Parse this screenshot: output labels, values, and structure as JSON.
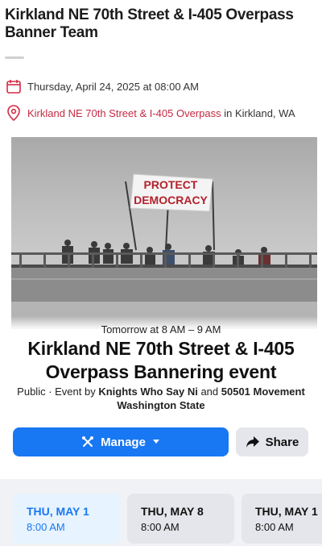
{
  "page": {
    "title": "Kirkland NE 70th Street & I-405 Overpass Banner Team"
  },
  "details": {
    "datetime": "Thursday, April 24, 2025 at 08:00 AM",
    "location_link": "Kirkland NE 70th Street & I-405 Overpass",
    "location_suffix": " in Kirkland, WA",
    "calendar_icon": "calendar-icon",
    "pin_icon": "location-pin-icon"
  },
  "photo": {
    "banner_line1": "PROTECT",
    "banner_line2": "DEMOCRACY"
  },
  "event": {
    "when": "Tomorrow at 8 AM – 9 AM",
    "name": "Kirkland NE 70th Street & I-405 Overpass Bannering event",
    "visibility_prefix": "Public · Event by ",
    "host1": "Knights Who Say Ni",
    "and": " and ",
    "host2": "50501 Movement Washington State"
  },
  "actions": {
    "manage_label": "Manage",
    "share_label": "Share",
    "manage_icon": "wrench-scissors-icon",
    "share_icon": "share-arrow-icon",
    "caret_icon": "caret-down-icon"
  },
  "dates": [
    {
      "day": "THU, MAY 1",
      "time": "8:00 AM",
      "selected": true
    },
    {
      "day": "THU, MAY 8",
      "time": "8:00 AM",
      "selected": false
    },
    {
      "day": "THU, MAY 1",
      "time": "8:00 AM",
      "selected": false
    }
  ],
  "colors": {
    "accent": "#1877f2",
    "location_link": "#c42a44",
    "calendar_icon": "#d42b45"
  }
}
